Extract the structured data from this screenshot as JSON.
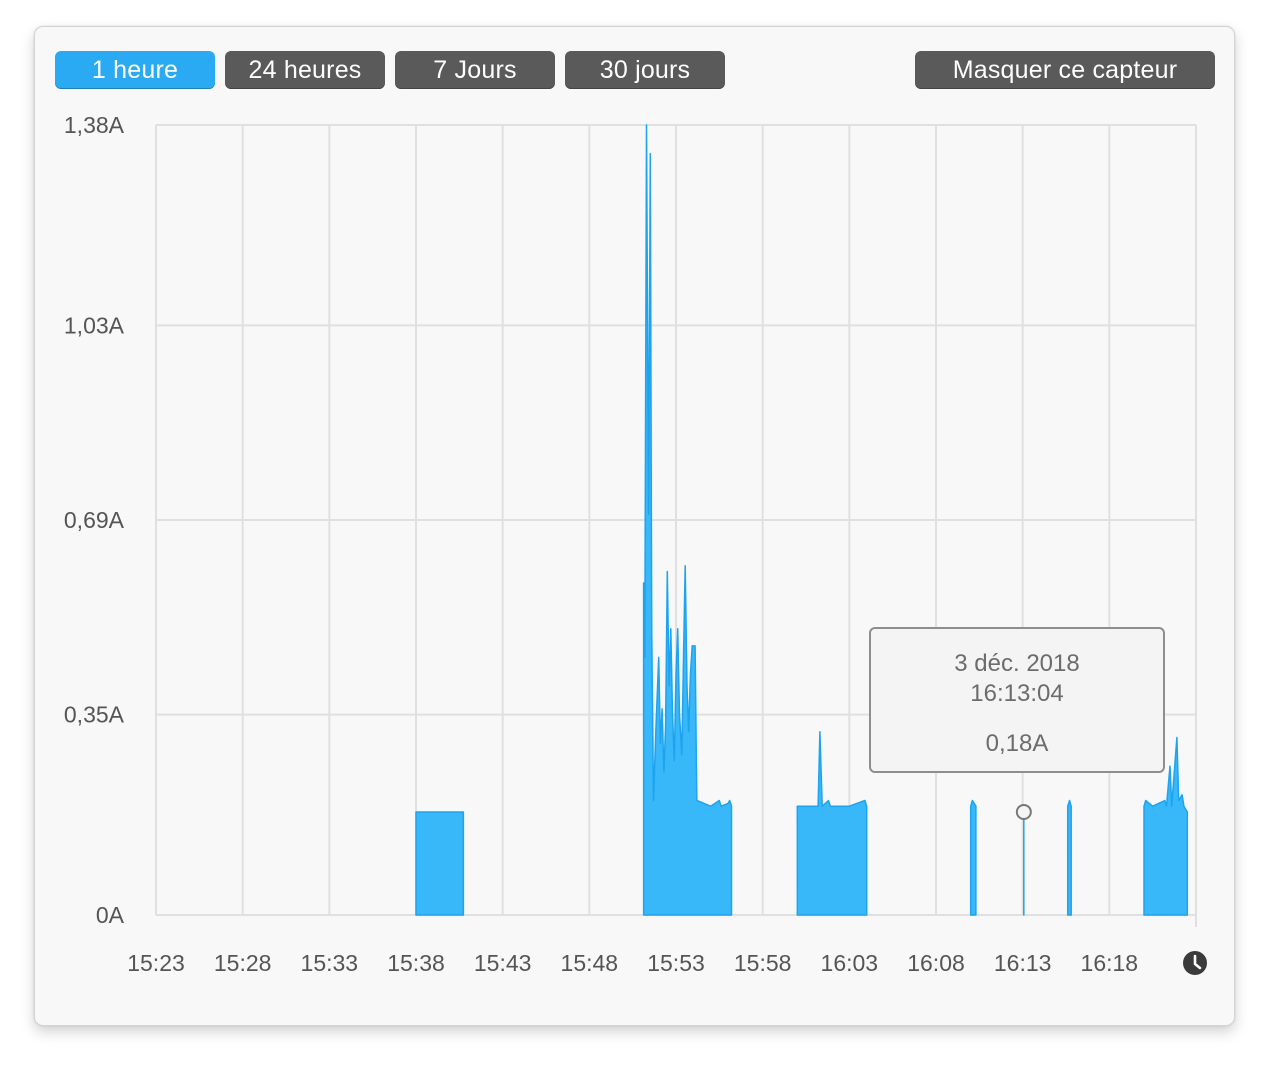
{
  "toolbar": {
    "periods": [
      "1 heure",
      "24 heures",
      "7 Jours",
      "30 jours"
    ],
    "active_period": "1 heure",
    "hide_sensor_label": "Masquer ce capteur"
  },
  "colors": {
    "accent": "#2aaaf3",
    "series_fill": "#38b8f8",
    "series_line": "#1ea3ef",
    "button": "#5a5a5a",
    "grid": "#e0e0e0"
  },
  "chart_data": {
    "type": "area",
    "title": "",
    "xlabel": "",
    "ylabel": "",
    "x_unit": "time (HH:MM)",
    "y_unit": "A",
    "xlim": [
      "15:23",
      "16:23"
    ],
    "ylim": [
      0,
      1.38
    ],
    "grid": true,
    "x_ticks": [
      "15:23",
      "15:28",
      "15:33",
      "15:38",
      "15:43",
      "15:48",
      "15:53",
      "15:58",
      "16:03",
      "16:08",
      "16:13",
      "16:18"
    ],
    "y_ticks": [
      "0A",
      "0,35A",
      "0,69A",
      "1,03A",
      "1,38A"
    ],
    "series": [
      {
        "points": [
          [
            "15:38:00",
            0.18
          ],
          [
            "15:38:30",
            0.18
          ],
          [
            "15:39:00",
            0.18
          ],
          [
            "15:39:30",
            0.18
          ],
          [
            "15:40:00",
            0.18
          ],
          [
            "15:40:44",
            0.18
          ],
          [
            "15:51:08",
            0.58
          ],
          [
            "15:51:12",
            0.45
          ],
          [
            "15:51:18",
            1.38
          ],
          [
            "15:51:25",
            0.7
          ],
          [
            "15:51:31",
            1.33
          ],
          [
            "15:51:36",
            0.5
          ],
          [
            "15:51:42",
            0.2
          ],
          [
            "15:51:50",
            0.32
          ],
          [
            "15:52:00",
            0.45
          ],
          [
            "15:52:06",
            0.3
          ],
          [
            "15:52:12",
            0.36
          ],
          [
            "15:52:18",
            0.25
          ],
          [
            "15:52:24",
            0.33
          ],
          [
            "15:52:30",
            0.6
          ],
          [
            "15:52:36",
            0.4
          ],
          [
            "15:52:42",
            0.5
          ],
          [
            "15:52:48",
            0.35
          ],
          [
            "15:52:54",
            0.27
          ],
          [
            "15:53:00",
            0.42
          ],
          [
            "15:53:06",
            0.5
          ],
          [
            "15:53:12",
            0.35
          ],
          [
            "15:53:20",
            0.28
          ],
          [
            "15:53:26",
            0.45
          ],
          [
            "15:53:32",
            0.61
          ],
          [
            "15:53:38",
            0.4
          ],
          [
            "15:53:44",
            0.32
          ],
          [
            "15:53:50",
            0.42
          ],
          [
            "15:53:56",
            0.47
          ],
          [
            "15:54:06",
            0.47
          ],
          [
            "15:54:12",
            0.2
          ],
          [
            "15:55:00",
            0.19
          ],
          [
            "15:55:30",
            0.2
          ],
          [
            "15:55:36",
            0.19
          ],
          [
            "15:56:00",
            0.195
          ],
          [
            "15:56:06",
            0.2
          ],
          [
            "15:56:12",
            0.19
          ],
          [
            "16:00:00",
            0.19
          ],
          [
            "16:01:12",
            0.19
          ],
          [
            "16:01:18",
            0.32
          ],
          [
            "16:01:26",
            0.19
          ],
          [
            "16:01:48",
            0.2
          ],
          [
            "16:01:54",
            0.19
          ],
          [
            "16:03:00",
            0.19
          ],
          [
            "16:03:54",
            0.2
          ],
          [
            "16:04:00",
            0.19
          ],
          [
            "16:10:00",
            0.19
          ],
          [
            "16:10:06",
            0.2
          ],
          [
            "16:10:18",
            0.19
          ],
          [
            "16:13:04",
            0.18
          ],
          [
            "16:15:36",
            0.19
          ],
          [
            "16:15:42",
            0.2
          ],
          [
            "16:15:48",
            0.19
          ],
          [
            "16:20:00",
            0.19
          ],
          [
            "16:20:06",
            0.2
          ],
          [
            "16:20:30",
            0.19
          ],
          [
            "16:21:12",
            0.2
          ],
          [
            "16:21:18",
            0.19
          ],
          [
            "16:21:30",
            0.26
          ],
          [
            "16:21:36",
            0.19
          ],
          [
            "16:21:54",
            0.31
          ],
          [
            "16:22:00",
            0.2
          ],
          [
            "16:22:12",
            0.21
          ],
          [
            "16:22:18",
            0.19
          ],
          [
            "16:22:30",
            0.18
          ]
        ]
      }
    ],
    "tooltip": {
      "date": "3 déc. 2018",
      "time": "16:13:04",
      "value": "0,18A"
    }
  }
}
